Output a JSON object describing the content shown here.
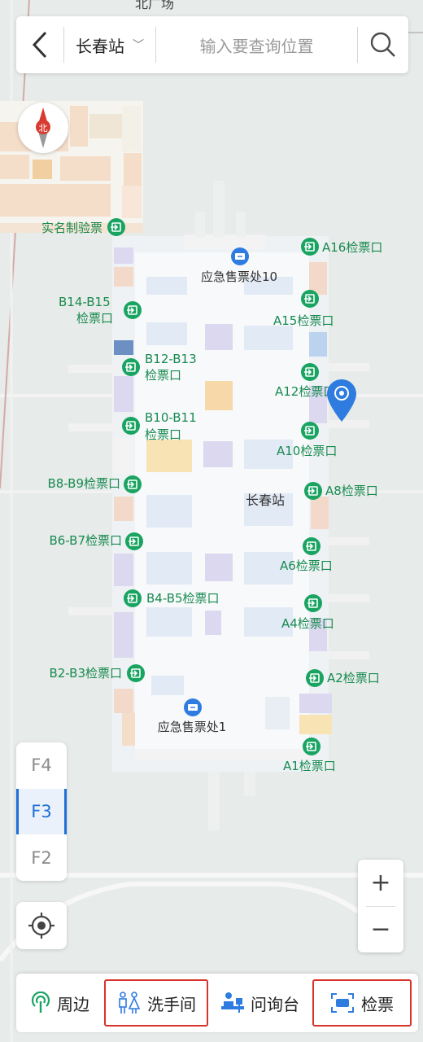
{
  "search": {
    "station": "长春站",
    "placeholder": "输入要查询位置"
  },
  "compass_label": "北",
  "area_label": "北广场",
  "station_label": "长春站",
  "pois": [
    {
      "label": "实名制验票",
      "kind": "gate"
    },
    {
      "label": "A16检票口",
      "kind": "gate"
    },
    {
      "label": "应急售票处10",
      "kind": "ticket"
    },
    {
      "label": "B14-B15",
      "kind": "gate",
      "line2": "检票口"
    },
    {
      "label": "A15检票口",
      "kind": "gate"
    },
    {
      "label": "B12-B13",
      "kind": "gate",
      "line2": "检票口"
    },
    {
      "label": "A12检票口",
      "kind": "gate"
    },
    {
      "label": "B10-B11",
      "kind": "gate",
      "line2": "检票口"
    },
    {
      "label": "A10检票口",
      "kind": "gate"
    },
    {
      "label": "B8-B9检票口",
      "kind": "gate"
    },
    {
      "label": "A8检票口",
      "kind": "gate"
    },
    {
      "label": "B6-B7检票口",
      "kind": "gate"
    },
    {
      "label": "A6检票口",
      "kind": "gate"
    },
    {
      "label": "B4-B5检票口",
      "kind": "gate"
    },
    {
      "label": "A4检票口",
      "kind": "gate"
    },
    {
      "label": "B2-B3检票口",
      "kind": "gate"
    },
    {
      "label": "A2检票口",
      "kind": "gate"
    },
    {
      "label": "应急售票处1",
      "kind": "ticket"
    },
    {
      "label": "A1检票口",
      "kind": "gate"
    }
  ],
  "floors": {
    "items": [
      "F4",
      "F3",
      "F2"
    ],
    "active": "F3"
  },
  "zoom": {
    "in": "+",
    "out": "−"
  },
  "bottom_bar": {
    "nearby": "周边",
    "toilet": "洗手间",
    "info_desk": "问询台",
    "ticket_check": "检票"
  },
  "colors": {
    "accent": "#1f6fd6",
    "poi_green": "#1aa462",
    "highlight_red": "#d9332b",
    "marker_blue": "#2e7ce0"
  }
}
